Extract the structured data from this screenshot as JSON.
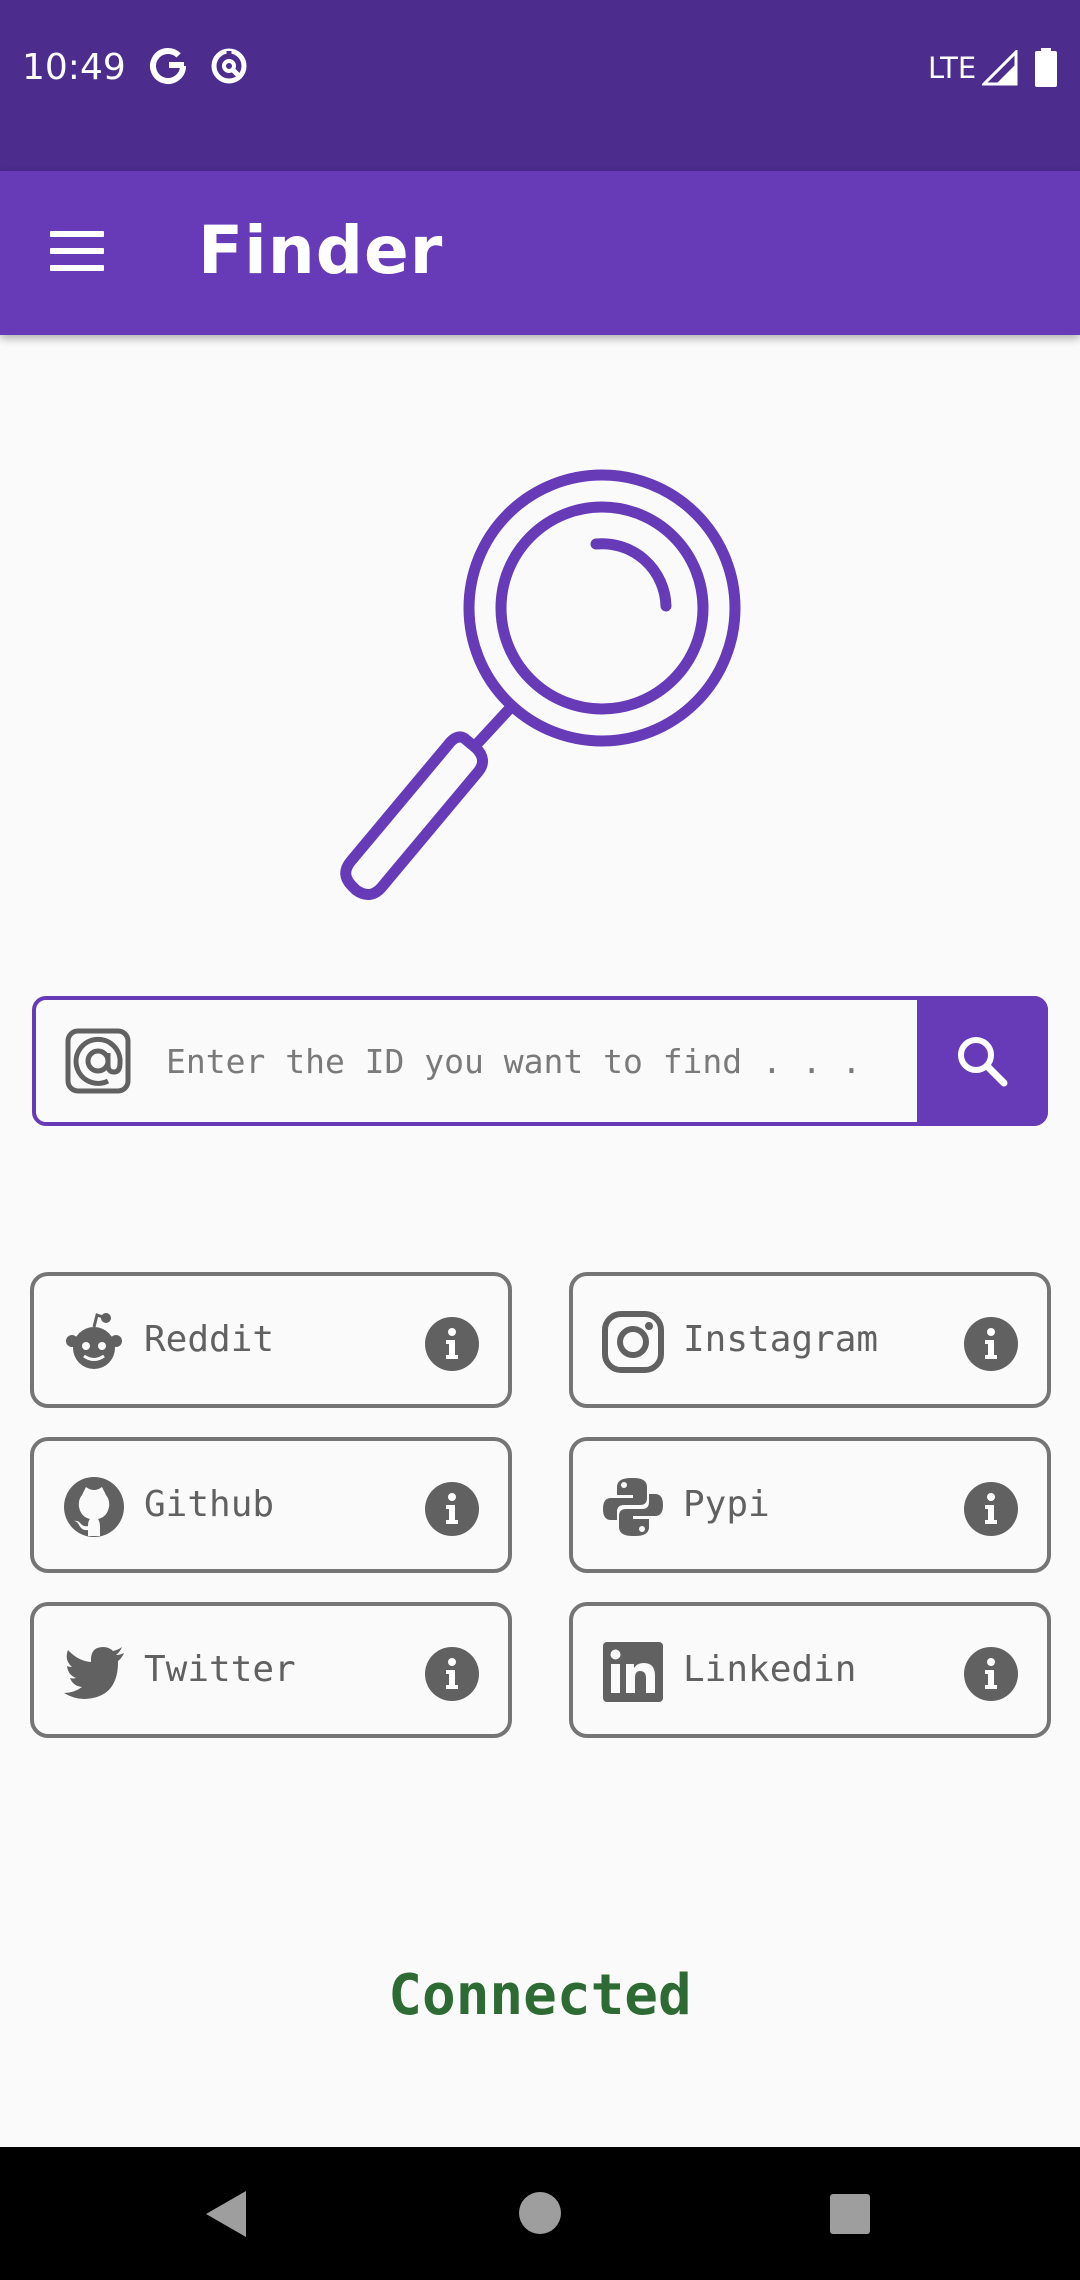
{
  "status_bar": {
    "time": "10:49",
    "network": "LTE",
    "icons": [
      "google-icon",
      "data-saver-icon",
      "signal-icon",
      "battery-icon"
    ]
  },
  "app_bar": {
    "title": "Finder",
    "menu_icon": "menu-icon"
  },
  "hero": {
    "icon": "magnifier-icon"
  },
  "search": {
    "placeholder": "Enter the ID you want to find . . .",
    "value": "",
    "prefix_icon": "at-sign-icon",
    "button_icon": "search-icon"
  },
  "sites": [
    {
      "label": "Reddit",
      "icon": "reddit-icon"
    },
    {
      "label": "Instagram",
      "icon": "instagram-icon"
    },
    {
      "label": "Github",
      "icon": "github-icon"
    },
    {
      "label": "Pypi",
      "icon": "python-icon"
    },
    {
      "label": "Twitter",
      "icon": "twitter-icon"
    },
    {
      "label": "Linkedin",
      "icon": "linkedin-icon"
    }
  ],
  "connection_status": "Connected",
  "colors": {
    "primary": "#673ab7",
    "status_bar": "#4c2c8c",
    "card_border": "#757575",
    "connected": "#2e6b34"
  }
}
